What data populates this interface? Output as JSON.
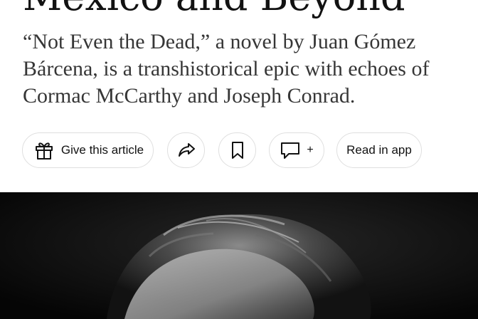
{
  "article": {
    "headline": "Mexico and Beyond",
    "summary": "“Not Even the Dead,” a novel by Juan Gómez Bárcena, is a transhistorical epic with echoes of Cormac McCarthy and Joseph Conrad."
  },
  "actions": {
    "gift": {
      "label": "Give this article",
      "icon": "gift-icon"
    },
    "share": {
      "icon": "share-arrow-icon"
    },
    "save": {
      "icon": "bookmark-icon"
    },
    "comments": {
      "icon": "comment-icon",
      "plus": "+"
    },
    "read_in_app": {
      "label": "Read in app"
    }
  },
  "image": {
    "description": "black-and-white portrait photo",
    "colors": {
      "background": "#0b0b0b"
    }
  },
  "colors": {
    "text_primary": "#121212",
    "text_summary": "#363636",
    "pill_border": "#dfdfdf"
  }
}
